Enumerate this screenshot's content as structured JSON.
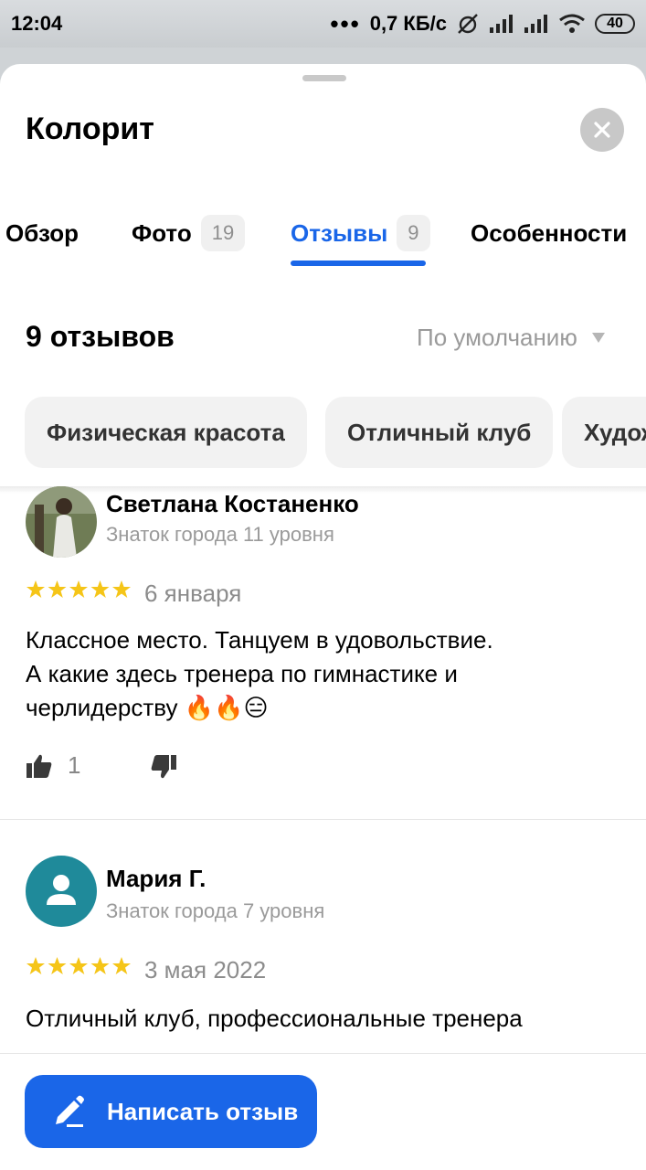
{
  "status_bar": {
    "time": "12:04",
    "network_speed": "0,7 КБ/с",
    "battery": "40"
  },
  "sheet": {
    "title": "Колорит"
  },
  "tabs": [
    {
      "label": "Обзор",
      "count": null
    },
    {
      "label": "Фото",
      "count": "19"
    },
    {
      "label": "Отзывы",
      "count": "9",
      "active": true
    },
    {
      "label": "Особенности",
      "count": null
    }
  ],
  "reviews_header": {
    "count_label": "9 отзывов",
    "sort_label": "По умолчанию"
  },
  "chips": [
    "Физическая красота",
    "Отличный клуб",
    "Худож"
  ],
  "reviews": [
    {
      "author": "Светлана Костаненко",
      "level": "Знаток города 11 уровня",
      "rating": 5,
      "date": "6 января",
      "text_line1": "Классное место.  Танцуем в удовольствие.",
      "text_line2": "А какие здесь тренера по гимнастике и",
      "text_line3": "черлидерству 🔥🔥😑",
      "likes": "1"
    },
    {
      "author": "Мария Г.",
      "level": "Знаток города 7 уровня",
      "rating": 5,
      "date": "3 мая 2022",
      "text_line1": "Отличный клуб, профессиональные тренера"
    }
  ],
  "write_review": {
    "label": "Написать отзыв"
  },
  "colors": {
    "accent": "#1a66e8",
    "star": "#f5c518",
    "avatar_teal": "#1f8a9a"
  }
}
